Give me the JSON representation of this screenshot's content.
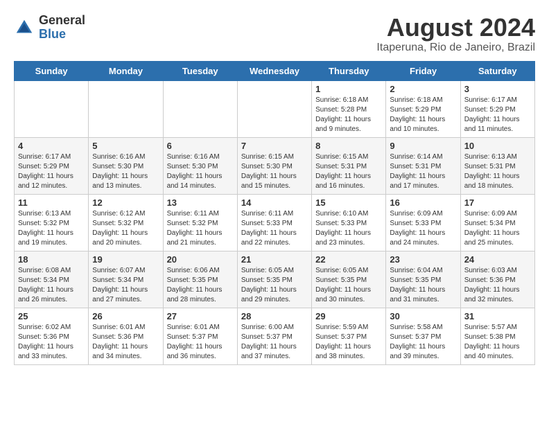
{
  "header": {
    "logo_general": "General",
    "logo_blue": "Blue",
    "title": "August 2024",
    "subtitle": "Itaperuna, Rio de Janeiro, Brazil"
  },
  "calendar": {
    "days_of_week": [
      "Sunday",
      "Monday",
      "Tuesday",
      "Wednesday",
      "Thursday",
      "Friday",
      "Saturday"
    ],
    "weeks": [
      [
        {
          "day": "",
          "info": ""
        },
        {
          "day": "",
          "info": ""
        },
        {
          "day": "",
          "info": ""
        },
        {
          "day": "",
          "info": ""
        },
        {
          "day": "1",
          "info": "Sunrise: 6:18 AM\nSunset: 5:28 PM\nDaylight: 11 hours and 9 minutes."
        },
        {
          "day": "2",
          "info": "Sunrise: 6:18 AM\nSunset: 5:29 PM\nDaylight: 11 hours and 10 minutes."
        },
        {
          "day": "3",
          "info": "Sunrise: 6:17 AM\nSunset: 5:29 PM\nDaylight: 11 hours and 11 minutes."
        }
      ],
      [
        {
          "day": "4",
          "info": "Sunrise: 6:17 AM\nSunset: 5:29 PM\nDaylight: 11 hours and 12 minutes."
        },
        {
          "day": "5",
          "info": "Sunrise: 6:16 AM\nSunset: 5:30 PM\nDaylight: 11 hours and 13 minutes."
        },
        {
          "day": "6",
          "info": "Sunrise: 6:16 AM\nSunset: 5:30 PM\nDaylight: 11 hours and 14 minutes."
        },
        {
          "day": "7",
          "info": "Sunrise: 6:15 AM\nSunset: 5:30 PM\nDaylight: 11 hours and 15 minutes."
        },
        {
          "day": "8",
          "info": "Sunrise: 6:15 AM\nSunset: 5:31 PM\nDaylight: 11 hours and 16 minutes."
        },
        {
          "day": "9",
          "info": "Sunrise: 6:14 AM\nSunset: 5:31 PM\nDaylight: 11 hours and 17 minutes."
        },
        {
          "day": "10",
          "info": "Sunrise: 6:13 AM\nSunset: 5:31 PM\nDaylight: 11 hours and 18 minutes."
        }
      ],
      [
        {
          "day": "11",
          "info": "Sunrise: 6:13 AM\nSunset: 5:32 PM\nDaylight: 11 hours and 19 minutes."
        },
        {
          "day": "12",
          "info": "Sunrise: 6:12 AM\nSunset: 5:32 PM\nDaylight: 11 hours and 20 minutes."
        },
        {
          "day": "13",
          "info": "Sunrise: 6:11 AM\nSunset: 5:32 PM\nDaylight: 11 hours and 21 minutes."
        },
        {
          "day": "14",
          "info": "Sunrise: 6:11 AM\nSunset: 5:33 PM\nDaylight: 11 hours and 22 minutes."
        },
        {
          "day": "15",
          "info": "Sunrise: 6:10 AM\nSunset: 5:33 PM\nDaylight: 11 hours and 23 minutes."
        },
        {
          "day": "16",
          "info": "Sunrise: 6:09 AM\nSunset: 5:33 PM\nDaylight: 11 hours and 24 minutes."
        },
        {
          "day": "17",
          "info": "Sunrise: 6:09 AM\nSunset: 5:34 PM\nDaylight: 11 hours and 25 minutes."
        }
      ],
      [
        {
          "day": "18",
          "info": "Sunrise: 6:08 AM\nSunset: 5:34 PM\nDaylight: 11 hours and 26 minutes."
        },
        {
          "day": "19",
          "info": "Sunrise: 6:07 AM\nSunset: 5:34 PM\nDaylight: 11 hours and 27 minutes."
        },
        {
          "day": "20",
          "info": "Sunrise: 6:06 AM\nSunset: 5:35 PM\nDaylight: 11 hours and 28 minutes."
        },
        {
          "day": "21",
          "info": "Sunrise: 6:05 AM\nSunset: 5:35 PM\nDaylight: 11 hours and 29 minutes."
        },
        {
          "day": "22",
          "info": "Sunrise: 6:05 AM\nSunset: 5:35 PM\nDaylight: 11 hours and 30 minutes."
        },
        {
          "day": "23",
          "info": "Sunrise: 6:04 AM\nSunset: 5:35 PM\nDaylight: 11 hours and 31 minutes."
        },
        {
          "day": "24",
          "info": "Sunrise: 6:03 AM\nSunset: 5:36 PM\nDaylight: 11 hours and 32 minutes."
        }
      ],
      [
        {
          "day": "25",
          "info": "Sunrise: 6:02 AM\nSunset: 5:36 PM\nDaylight: 11 hours and 33 minutes."
        },
        {
          "day": "26",
          "info": "Sunrise: 6:01 AM\nSunset: 5:36 PM\nDaylight: 11 hours and 34 minutes."
        },
        {
          "day": "27",
          "info": "Sunrise: 6:01 AM\nSunset: 5:37 PM\nDaylight: 11 hours and 36 minutes."
        },
        {
          "day": "28",
          "info": "Sunrise: 6:00 AM\nSunset: 5:37 PM\nDaylight: 11 hours and 37 minutes."
        },
        {
          "day": "29",
          "info": "Sunrise: 5:59 AM\nSunset: 5:37 PM\nDaylight: 11 hours and 38 minutes."
        },
        {
          "day": "30",
          "info": "Sunrise: 5:58 AM\nSunset: 5:37 PM\nDaylight: 11 hours and 39 minutes."
        },
        {
          "day": "31",
          "info": "Sunrise: 5:57 AM\nSunset: 5:38 PM\nDaylight: 11 hours and 40 minutes."
        }
      ]
    ]
  }
}
